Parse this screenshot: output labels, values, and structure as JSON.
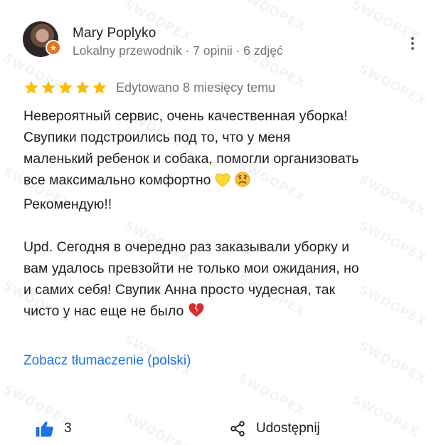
{
  "watermark": {
    "text": "SWOOPEX"
  },
  "author": {
    "name": "Mary Poplyko",
    "meta": "Lokalny przewodnik · 7 opinii · 6 zdjęć"
  },
  "rating": {
    "stars": 5,
    "max": 5,
    "color": "#fbbc04"
  },
  "edited": "Edytowano 8 miesięcy temu",
  "review": {
    "line1": "Невероятный сервис, очень качественная уборка!",
    "line2": "Свупики подстроились под то, что у меня",
    "line3": "маленький ребенок и собака, помогли организовать",
    "line4": "все максимально комфортно",
    "line4_emoji": [
      "yellow-heart",
      "frowning-face"
    ],
    "line5": "Рекомендую!!",
    "line6": "Upd. Сегодня в очередно раз заказывали уборку и",
    "line7": "вам удалось превзойти не только мои ожидания, но",
    "line8": "и самих себя! Свупик Анна просто чудесная, так",
    "line9": "чисто у нас еще не было",
    "line9_emoji": [
      "broken-heart"
    ]
  },
  "translate_link": "Zobacz tłumaczenie (polski)",
  "actions": {
    "like_count": "3",
    "share_label": "Udostępnij"
  },
  "colors": {
    "accent": "#1a73e8",
    "meta_gray": "#70757a",
    "badge": "#e8711a"
  }
}
